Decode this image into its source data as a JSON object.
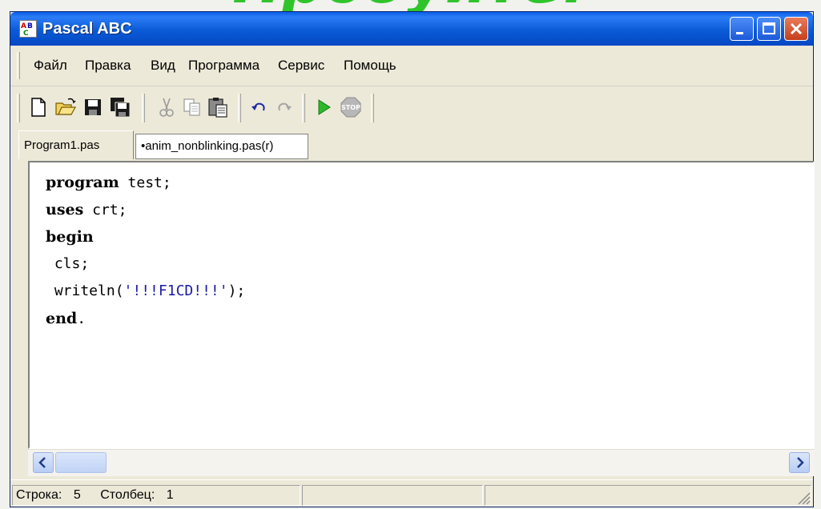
{
  "slide": {
    "heading": "Пробуйте!"
  },
  "window": {
    "title": "Pascal ABC",
    "controls": [
      "minimize",
      "maximize",
      "close"
    ]
  },
  "menu": [
    "Файл",
    "Правка",
    "Вид",
    "Программа",
    "Сервис",
    "Помощь"
  ],
  "toolbar": {
    "buttons": [
      "new-file-icon",
      "open-folder-icon",
      "save-icon",
      "save-all-icon",
      "cut-icon",
      "copy-icon",
      "paste-icon",
      "undo-icon",
      "redo-icon",
      "run-icon",
      "stop-icon"
    ]
  },
  "tabs": [
    {
      "label": "Program1.pas",
      "active": true
    },
    {
      "label": "•anim_nonblinking.pas(r)",
      "active": false
    }
  ],
  "editor": {
    "lines": [
      {
        "kw": "program",
        "rest": " test;"
      },
      {
        "kw": "uses",
        "rest": " crt;"
      },
      {
        "kw": "begin",
        "rest": ""
      },
      {
        "pre": " cls;"
      },
      {
        "pre": " writeln(",
        "str": "'!!!F1CD!!!'",
        "post": ");"
      },
      {
        "kw": "end",
        "rest": "."
      }
    ]
  },
  "status": {
    "row_label": "Строка:",
    "row_value": "5",
    "col_label": "Столбец:",
    "col_value": "1"
  },
  "colors": {
    "heading": "#2fc52a",
    "titlebar": "#0a5ad6",
    "close_button": "#c4401c",
    "string_literal": "#1a1aa8"
  }
}
